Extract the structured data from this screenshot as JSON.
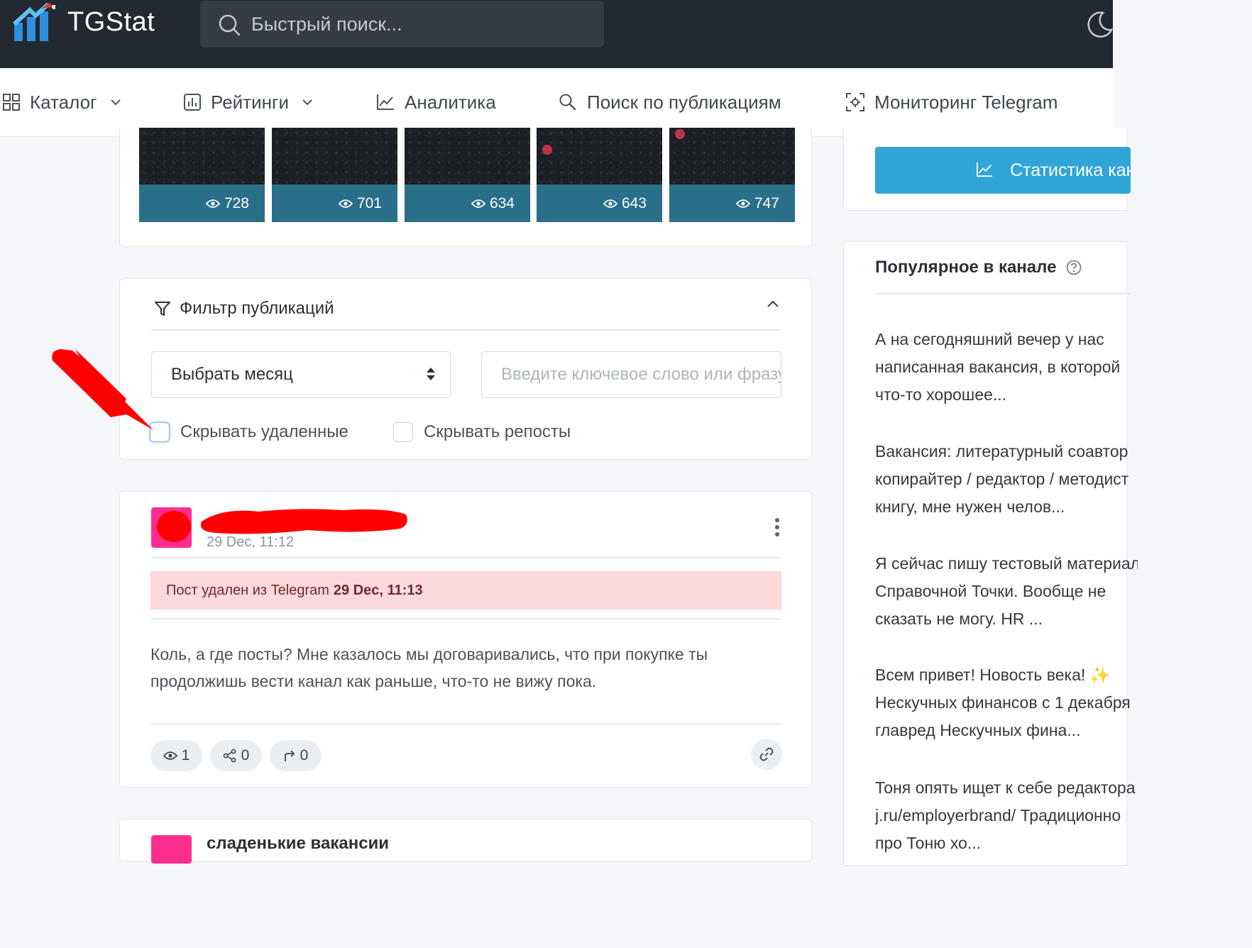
{
  "topbar": {
    "brand": "TGStat",
    "search_placeholder": "Быстрый поиск..."
  },
  "nav": {
    "items": [
      {
        "label": "Каталог"
      },
      {
        "label": "Рейтинги"
      },
      {
        "label": "Аналитика"
      },
      {
        "label": "Поиск по публикациям"
      },
      {
        "label": "Мониторинг Telegram"
      }
    ]
  },
  "thumbnails": [
    {
      "views": "728"
    },
    {
      "views": "701"
    },
    {
      "views": "634"
    },
    {
      "views": "643"
    },
    {
      "views": "747"
    }
  ],
  "filter": {
    "title": "Фильтр публикаций",
    "month_select": "Выбрать месяц",
    "keyword_placeholder": "Введите ключевое слово или фразу",
    "hide_deleted_label": "Скрывать удаленные",
    "hide_reposts_label": "Скрывать репосты"
  },
  "post": {
    "date": "29 Dec, 11:12",
    "deleted_prefix": "Пост удален из Telegram",
    "deleted_time": "29 Dec, 11:13",
    "text": "Коль, а где посты? Мне казалось мы договаривались, что при покупке ты продолжишь вести канал как раньше, что-то не вижу пока.",
    "views": "1",
    "shares": "0",
    "forwards": "0"
  },
  "post2": {
    "title": "сладенькие вакансии"
  },
  "sidebar": {
    "stat_button": "Статистика канала",
    "popular_title": "Популярное в канале",
    "popular_items": [
      [
        "А на сегодняшний вечер у нас",
        "написанная вакансия, в которой",
        "что-то хорошее..."
      ],
      [
        "Вакансия: литературный соавтор",
        "копирайтер / редактор / методист",
        "книгу, мне нужен челов..."
      ],
      [
        "Я сейчас пишу тестовый материал",
        "Справочной Точки. Вообще не",
        "сказать не могу. HR ..."
      ],
      [
        "Всем привет! Новость века! ✨",
        "Нескучных финансов с 1 декабря",
        "главред Нескучных фина..."
      ],
      [
        "Тоня опять ищет к себе редактора",
        "j.ru/employerbrand/ Традиционно",
        "про Тоню хо..."
      ]
    ]
  },
  "colors": {
    "topbar": "#232931",
    "accent": "#2fa6d7",
    "thumb_bar": "#2a6f89",
    "deleted_bg": "#fcd9da",
    "avatar": "#ff2d8e",
    "annotation": "#ff0000"
  }
}
